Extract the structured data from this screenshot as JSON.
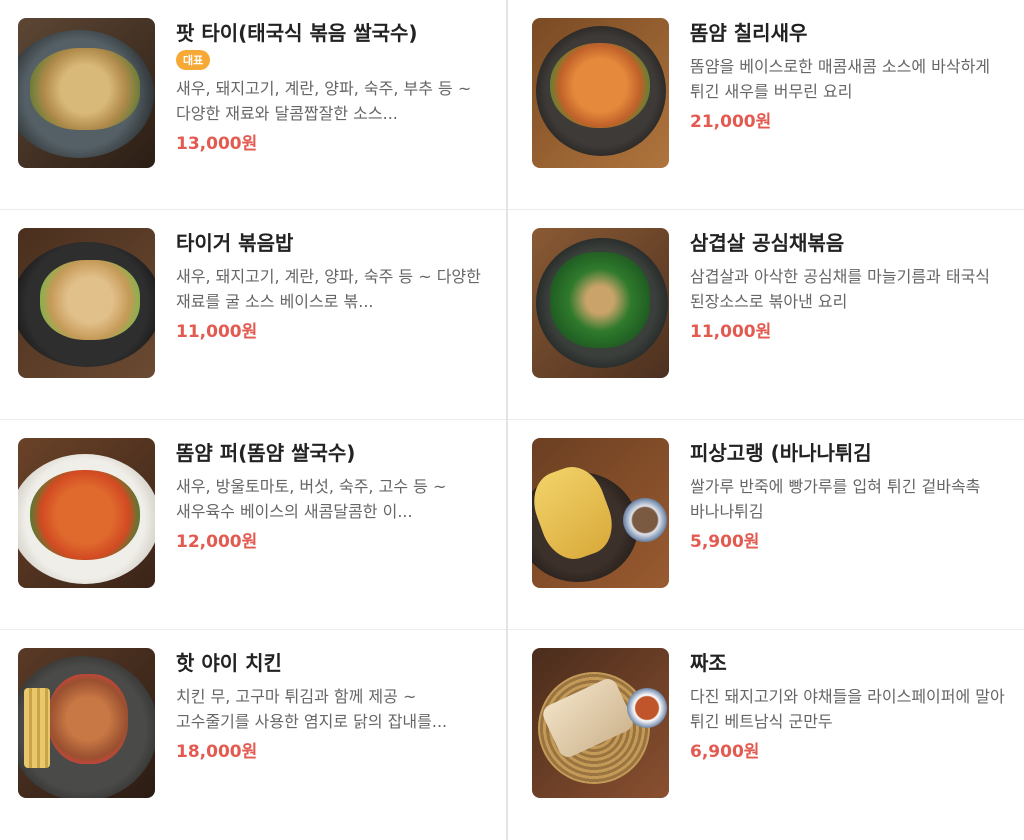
{
  "menu": {
    "left": [
      {
        "name": "팟 타이(태국식 볶음 쌀국수)",
        "badge": "대표",
        "description": "새우, 돼지고기, 계란, 양파, 숙주, 부추 등 ~ 다양한 재료와 달콤짭잘한 소스...",
        "price": "13,000원",
        "image": "pad-thai-photo"
      },
      {
        "name": "타이거 볶음밥",
        "description": "새우, 돼지고기, 계란, 양파, 숙주 등 ~ 다양한 재료를 굴 소스 베이스로 볶...",
        "price": "11,000원",
        "image": "fried-rice-photo"
      },
      {
        "name": "똠얌 퍼(똠얌 쌀국수)",
        "description": "새우, 방울토마토, 버섯, 숙주, 고수 등 ~ 새우육수 베이스의 새콤달콤한 이...",
        "price": "12,000원",
        "image": "tom-yum-pho-photo"
      },
      {
        "name": "핫 야이 치킨",
        "description": "치킨 무, 고구마 튀김과 함께 제공 ~ 고수줄기를 사용한 염지로 닭의 잡내를...",
        "price": "18,000원",
        "image": "hat-yai-chicken-photo"
      }
    ],
    "right": [
      {
        "name": "똠얌 칠리새우",
        "description": "똠얌을 베이스로한 매콤새콤 소스에 바삭하게 튀긴 새우를 버무린 요리",
        "price": "21,000원",
        "image": "tom-yum-chili-shrimp-photo"
      },
      {
        "name": "삼겹살 공심채볶음",
        "description": "삼겹살과 아삭한 공심채를 마늘기름과 태국식 된장소스로 볶아낸 요리",
        "price": "11,000원",
        "image": "pork-morning-glory-photo"
      },
      {
        "name": "피상고랭 (바나나튀김",
        "description": "쌀가루 반죽에 빵가루를 입혀 튀긴 겉바속촉 바나나튀김",
        "price": "5,900원",
        "image": "banana-fritter-photo"
      },
      {
        "name": "짜조",
        "description": "다진 돼지고기와 야채들을 라이스페이퍼에 말아 튀긴 베트남식 군만두",
        "price": "6,900원",
        "image": "cha-gio-photo"
      }
    ]
  },
  "colors": {
    "price": "#e35a50",
    "badge": "#f7a935",
    "name": "#222222",
    "description": "#666666"
  }
}
